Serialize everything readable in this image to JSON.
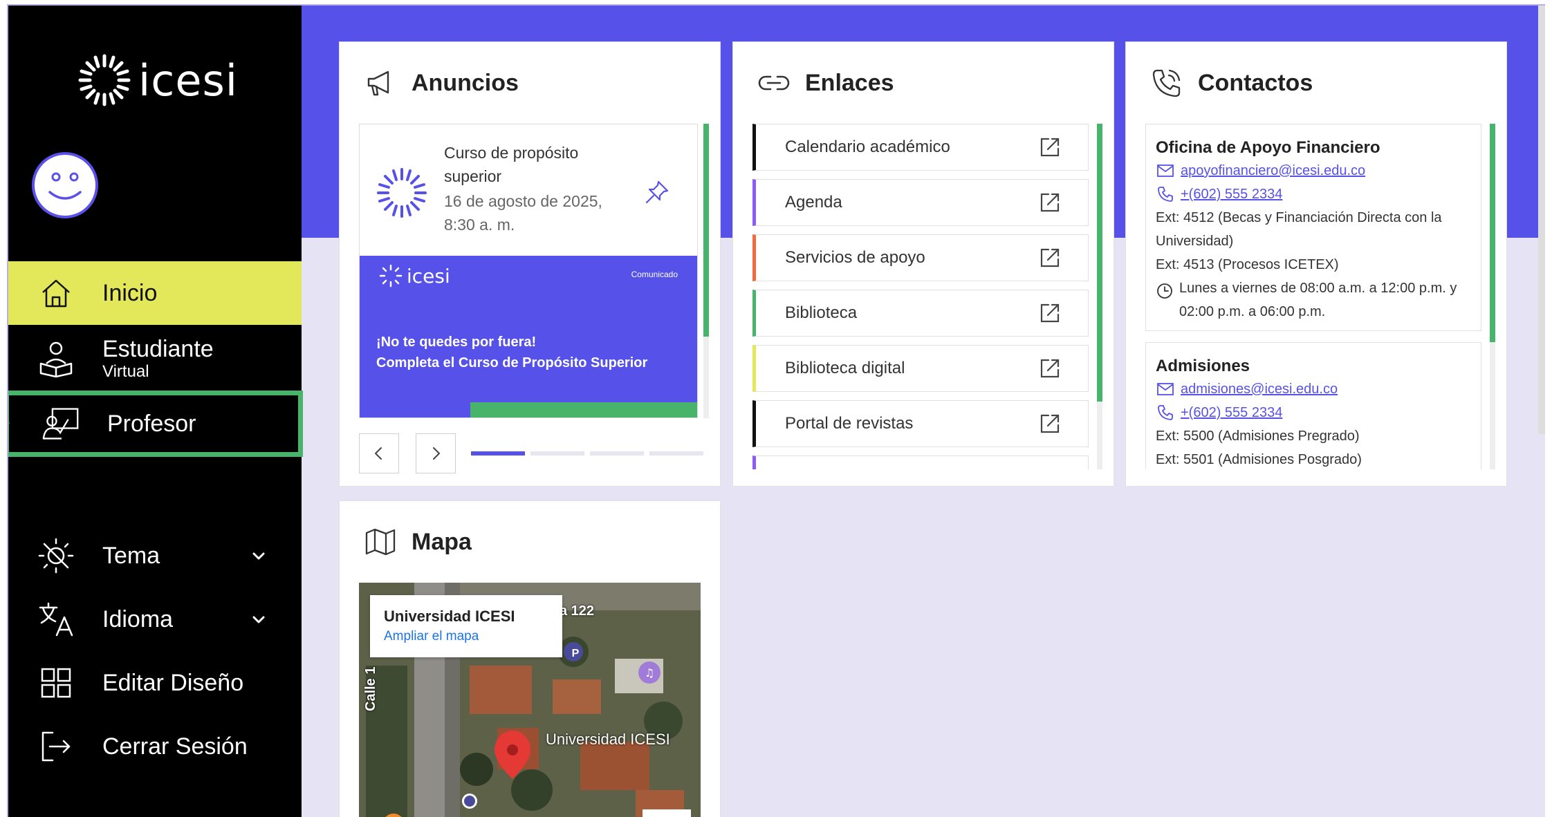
{
  "brand": {
    "name": "icesi"
  },
  "sidebar": {
    "nav": [
      {
        "id": "inicio",
        "label": "Inicio",
        "icon": "home-icon"
      },
      {
        "id": "estudiante",
        "label": "Estudiante",
        "sublabel": "Virtual",
        "icon": "student-icon"
      },
      {
        "id": "profesor",
        "label": "Profesor",
        "icon": "teacher-icon"
      }
    ],
    "settings": [
      {
        "id": "tema",
        "label": "Tema",
        "icon": "theme-icon"
      },
      {
        "id": "idioma",
        "label": "Idioma",
        "icon": "translate-icon"
      },
      {
        "id": "editar",
        "label": "Editar Diseño",
        "icon": "layout-icon"
      },
      {
        "id": "cerrar",
        "label": "Cerrar Sesión",
        "icon": "logout-icon"
      }
    ]
  },
  "anuncios": {
    "title": "Anuncios",
    "item": {
      "title": "Curso de propósito superior",
      "date": "16 de agosto de 2025, 8:30 a. m."
    },
    "banner": {
      "brand": "icesi",
      "tag": "Comunicado",
      "line1": "¡No te quedes por fuera!",
      "line2": "Completa el Curso de Propósito Superior"
    },
    "active_slide": 1,
    "slide_count": 4
  },
  "enlaces": {
    "title": "Enlaces",
    "items": [
      {
        "label": "Calendario académico",
        "color": "#111111"
      },
      {
        "label": "Agenda",
        "color": "#8b5cf6"
      },
      {
        "label": "Servicios de apoyo",
        "color": "#f06a3c"
      },
      {
        "label": "Biblioteca",
        "color": "#48b36b"
      },
      {
        "label": "Biblioteca digital",
        "color": "#e3e85b"
      },
      {
        "label": "Portal de revistas",
        "color": "#111111"
      }
    ]
  },
  "contactos": {
    "title": "Contactos",
    "items": [
      {
        "name": "Oficina de Apoyo Financiero",
        "email": "apoyofinanciero@icesi.edu.co",
        "phone": "+(602) 555 2334",
        "ext1": "Ext: 4512 (Becas y Financiación Directa con la Universidad)",
        "ext2": "Ext: 4513 (Procesos ICETEX)",
        "hours": "Lunes a viernes de 08:00 a.m. a 12:00 p.m. y 02:00 p.m. a 06:00 p.m."
      },
      {
        "name": "Admisiones",
        "email": "admisiones@icesi.edu.co",
        "phone": "+(602) 555 2334",
        "ext1": "Ext: 5500 (Admisiones Pregrado)",
        "ext2": "Ext: 5501 (Admisiones Posgrado)"
      }
    ]
  },
  "mapa": {
    "title": "Mapa",
    "place": "Universidad ICESI",
    "link": "Ampliar el mapa",
    "marker_label": "Universidad ICESI",
    "street_1": "a 122",
    "street_2": "Calle 1"
  },
  "colors": {
    "accent": "#5651e9",
    "active_nav": "#e3e85b",
    "success": "#48b36b"
  }
}
